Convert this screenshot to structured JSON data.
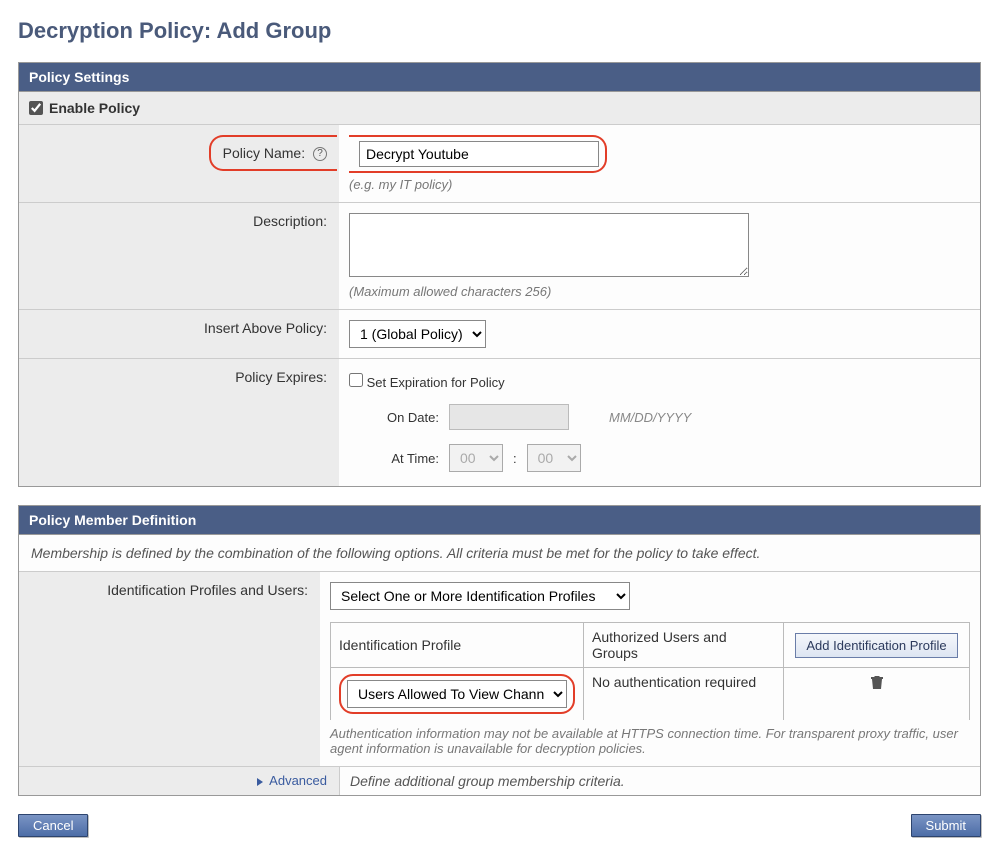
{
  "page": {
    "title": "Decryption Policy: Add Group"
  },
  "policy_settings": {
    "header": "Policy Settings",
    "enable_label": "Enable Policy",
    "enable_checked": true,
    "policy_name": {
      "label": "Policy Name:",
      "value": "Decrypt Youtube",
      "hint": "(e.g. my IT policy)"
    },
    "description": {
      "label": "Description:",
      "hint": "(Maximum allowed characters 256)"
    },
    "insert_above": {
      "label": "Insert Above Policy:",
      "selected": "1 (Global Policy)"
    },
    "expires": {
      "label": "Policy Expires:",
      "checkbox_label": "Set Expiration for Policy",
      "on_date_label": "On Date:",
      "on_date_hint": "MM/DD/YYYY",
      "at_time_label": "At Time:",
      "hour": "00",
      "minute": "00"
    }
  },
  "member_def": {
    "header": "Policy Member Definition",
    "description": "Membership is defined by the combination of the following options. All criteria must be met for the policy to take effect.",
    "profiles": {
      "label": "Identification Profiles and Users:",
      "select_label": "Select One or More Identification Profiles",
      "col_profile": "Identification Profile",
      "col_users": "Authorized Users and Groups",
      "add_btn": "Add Identification Profile",
      "row_profile": "Users Allowed To View Channel",
      "row_users": "No authentication required",
      "auth_note": "Authentication information may not be available at HTTPS connection time. For transparent proxy traffic, user agent information is unavailable for decryption policies."
    },
    "advanced": {
      "label": "Advanced",
      "text": "Define additional group membership criteria."
    }
  },
  "footer": {
    "cancel": "Cancel",
    "submit": "Submit"
  }
}
